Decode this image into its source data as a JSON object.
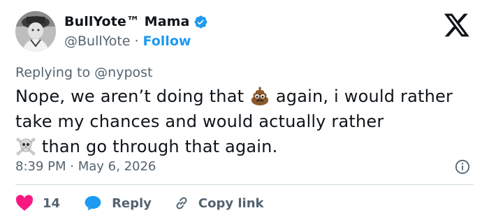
{
  "author": {
    "display_name": "BullYote™ Mama",
    "handle": "@BullYote",
    "separator": "·",
    "follow_label": "Follow"
  },
  "reply_context": {
    "prefix": "Replying to",
    "mention": "@nypost"
  },
  "tweet": {
    "part1": "Nope,  we aren’t doing that ",
    "part2": " again,  i would rather take my chances and would actually rather",
    "part3": " than go through that again.",
    "emoji_1": "pile-of-poo",
    "emoji_2": "skull-and-crossbones"
  },
  "meta": {
    "time": "8:39 PM",
    "separator": "·",
    "date": "May 6, 2026"
  },
  "actions": {
    "like_count": "14",
    "reply_label": "Reply",
    "copy_label": "Copy link"
  },
  "icons": {
    "verified": "verified-badge-icon",
    "x_logo": "x-logo-icon",
    "info": "info-icon",
    "like": "heart-icon",
    "reply": "speech-bubble-icon",
    "copy": "link-icon"
  },
  "colors": {
    "verified_blue": "#1d9bf0",
    "like_pink": "#f91880",
    "text_primary": "#0f1419",
    "text_secondary": "#536471"
  }
}
